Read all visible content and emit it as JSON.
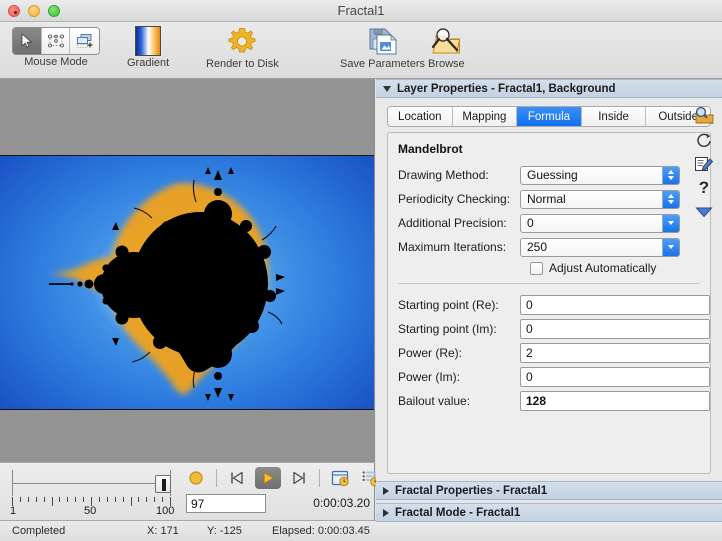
{
  "window": {
    "title": "Fractal1",
    "traffic_lights": [
      "close-button",
      "minimize-button",
      "zoom-button"
    ]
  },
  "toolbar": {
    "items": [
      {
        "label": "Mouse Mode",
        "icon": "cursor-arrow-icon",
        "segments": [
          "cursor-arrow-icon",
          "node-select-icon",
          "layer-add-icon"
        ],
        "selected_segment": 0
      },
      {
        "label": "Gradient",
        "icon": "gradient-swatch-icon"
      },
      {
        "label": "Render to Disk",
        "icon": "gear-icon"
      },
      {
        "label": "Save Parameters",
        "icon": "save-documents-icon"
      },
      {
        "label": "Browse",
        "icon": "browse-folder-magnifier-icon"
      }
    ]
  },
  "canvas": {
    "name": "fractal-render-canvas",
    "background_color": "#949494",
    "fractal": {
      "type": "mandelbrot",
      "interior_color": "#000000",
      "gradient_colors": [
        "#1442ad",
        "#2f7ee0",
        "#63b6f2",
        "#ffffff",
        "#f5b64a",
        "#e08a10"
      ]
    }
  },
  "timeline": {
    "slider": {
      "min_label": "1",
      "mid_label": "50",
      "max_label": "100",
      "value": 97
    },
    "transport": [
      {
        "name": "record-button",
        "icon": "record-circle-icon",
        "selected": false
      },
      {
        "name": "previous-frame-button",
        "icon": "skip-back-icon",
        "selected": false
      },
      {
        "name": "play-button",
        "icon": "play-triangle-icon",
        "selected": true
      },
      {
        "name": "next-frame-button",
        "icon": "skip-forward-icon",
        "selected": false
      },
      {
        "name": "render-time-window-button",
        "icon": "window-clock-icon",
        "selected": false
      },
      {
        "name": "timeline-settings-button",
        "icon": "list-clock-icon",
        "selected": false
      }
    ],
    "frame_value": "97",
    "time_display": "0:00:03.20"
  },
  "statusbar": {
    "status": "Completed",
    "x_label": "X: 171",
    "y_label": "Y: -125",
    "elapsed": "Elapsed: 0:00:03.45"
  },
  "inspector": {
    "sections": [
      {
        "title": "Layer Properties - Fractal1, Background",
        "expanded": true
      },
      {
        "title": "Fractal Properties - Fractal1",
        "expanded": false
      },
      {
        "title": "Fractal Mode - Fractal1",
        "expanded": false
      }
    ],
    "tabs": [
      {
        "label": "Location",
        "active": false
      },
      {
        "label": "Mapping",
        "active": false
      },
      {
        "label": "Formula",
        "active": true
      },
      {
        "label": "Inside",
        "active": false
      },
      {
        "label": "Outside",
        "active": false
      }
    ],
    "formula": {
      "name": "Mandelbrot",
      "popups": [
        {
          "label": "Drawing Method:",
          "value": "Guessing",
          "control": "popup"
        },
        {
          "label": "Periodicity Checking:",
          "value": "Normal",
          "control": "popup"
        },
        {
          "label": "Additional Precision:",
          "value": "0",
          "control": "combo"
        },
        {
          "label": "Maximum Iterations:",
          "value": "250",
          "control": "combo"
        }
      ],
      "checkbox": {
        "label": "Adjust Automatically",
        "checked": false
      },
      "fields": [
        {
          "label": "Starting point (Re):",
          "value": "0",
          "bold": false
        },
        {
          "label": "Starting point (Im):",
          "value": "0",
          "bold": false
        },
        {
          "label": "Power (Re):",
          "value": "2",
          "bold": false
        },
        {
          "label": "Power (Im):",
          "value": "0",
          "bold": false
        },
        {
          "label": "Bailout value:",
          "value": "128",
          "bold": true
        }
      ],
      "side_icons": [
        {
          "name": "browse-formula-icon"
        },
        {
          "name": "reset-circular-arrow-icon"
        },
        {
          "name": "edit-formula-icon"
        },
        {
          "name": "help-question-icon"
        },
        {
          "name": "collapse-triangle-icon"
        }
      ]
    }
  },
  "colors": {
    "accent_blue": "#1070ef",
    "panel_header": "#c7d5e5",
    "canvas_gray": "#949494"
  }
}
